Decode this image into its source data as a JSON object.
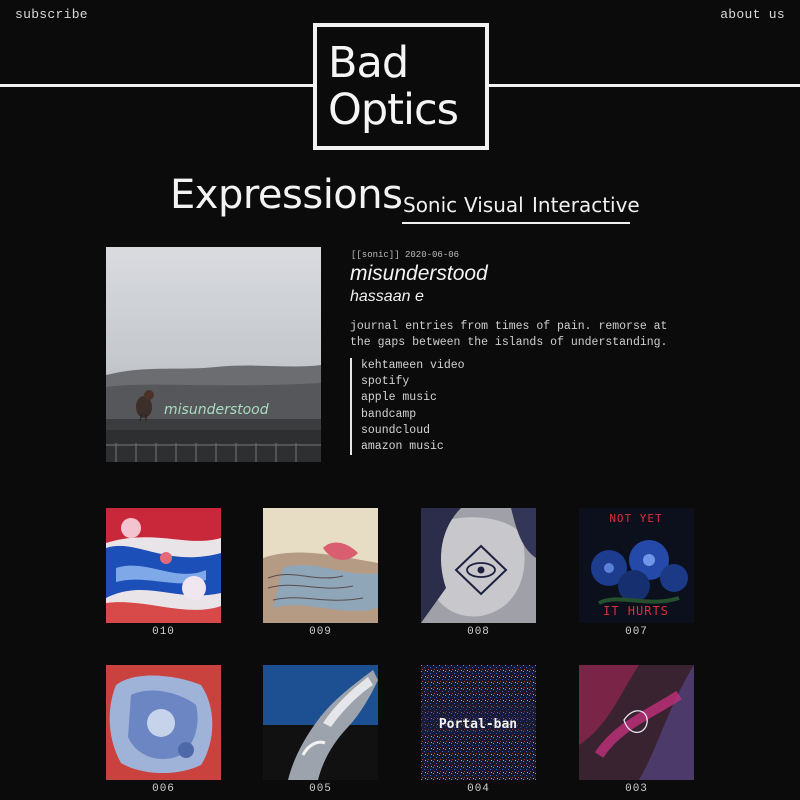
{
  "nav": {
    "subscribe": "subscribe",
    "about": "about us"
  },
  "logo": {
    "line1": "Bad",
    "line2": "Optics"
  },
  "section": {
    "heading": "Expressions",
    "tabs": [
      "Sonic",
      "Visual",
      "Interactive"
    ]
  },
  "feature": {
    "meta": "[[sonic]] 2020-06-06",
    "title": "misunderstood",
    "artist": "hassaan e",
    "description": "journal entries from times of pain. remorse at the gaps between the islands of understanding.",
    "art_text": "misunderstood",
    "links": [
      "kehtameen video",
      "spotify",
      "apple music",
      "bandcamp",
      "soundcloud",
      "amazon music"
    ]
  },
  "grid": [
    {
      "num": "010",
      "icon": "abstract-red-blue-art"
    },
    {
      "num": "009",
      "icon": "pastel-illustration-art"
    },
    {
      "num": "008",
      "icon": "eye-triangle-sketch-art",
      "art_text": ""
    },
    {
      "num": "007",
      "icon": "blue-flowers-art",
      "art_text_top": "NOT YET",
      "art_text_bottom": "IT HURTS"
    },
    {
      "num": "006",
      "icon": "blue-cloud-paint-art"
    },
    {
      "num": "005",
      "icon": "chrome-sculpture-art"
    },
    {
      "num": "004",
      "icon": "noise-field-art",
      "art_text": "Portal-ban"
    },
    {
      "num": "003",
      "icon": "purple-smoke-art"
    }
  ]
}
